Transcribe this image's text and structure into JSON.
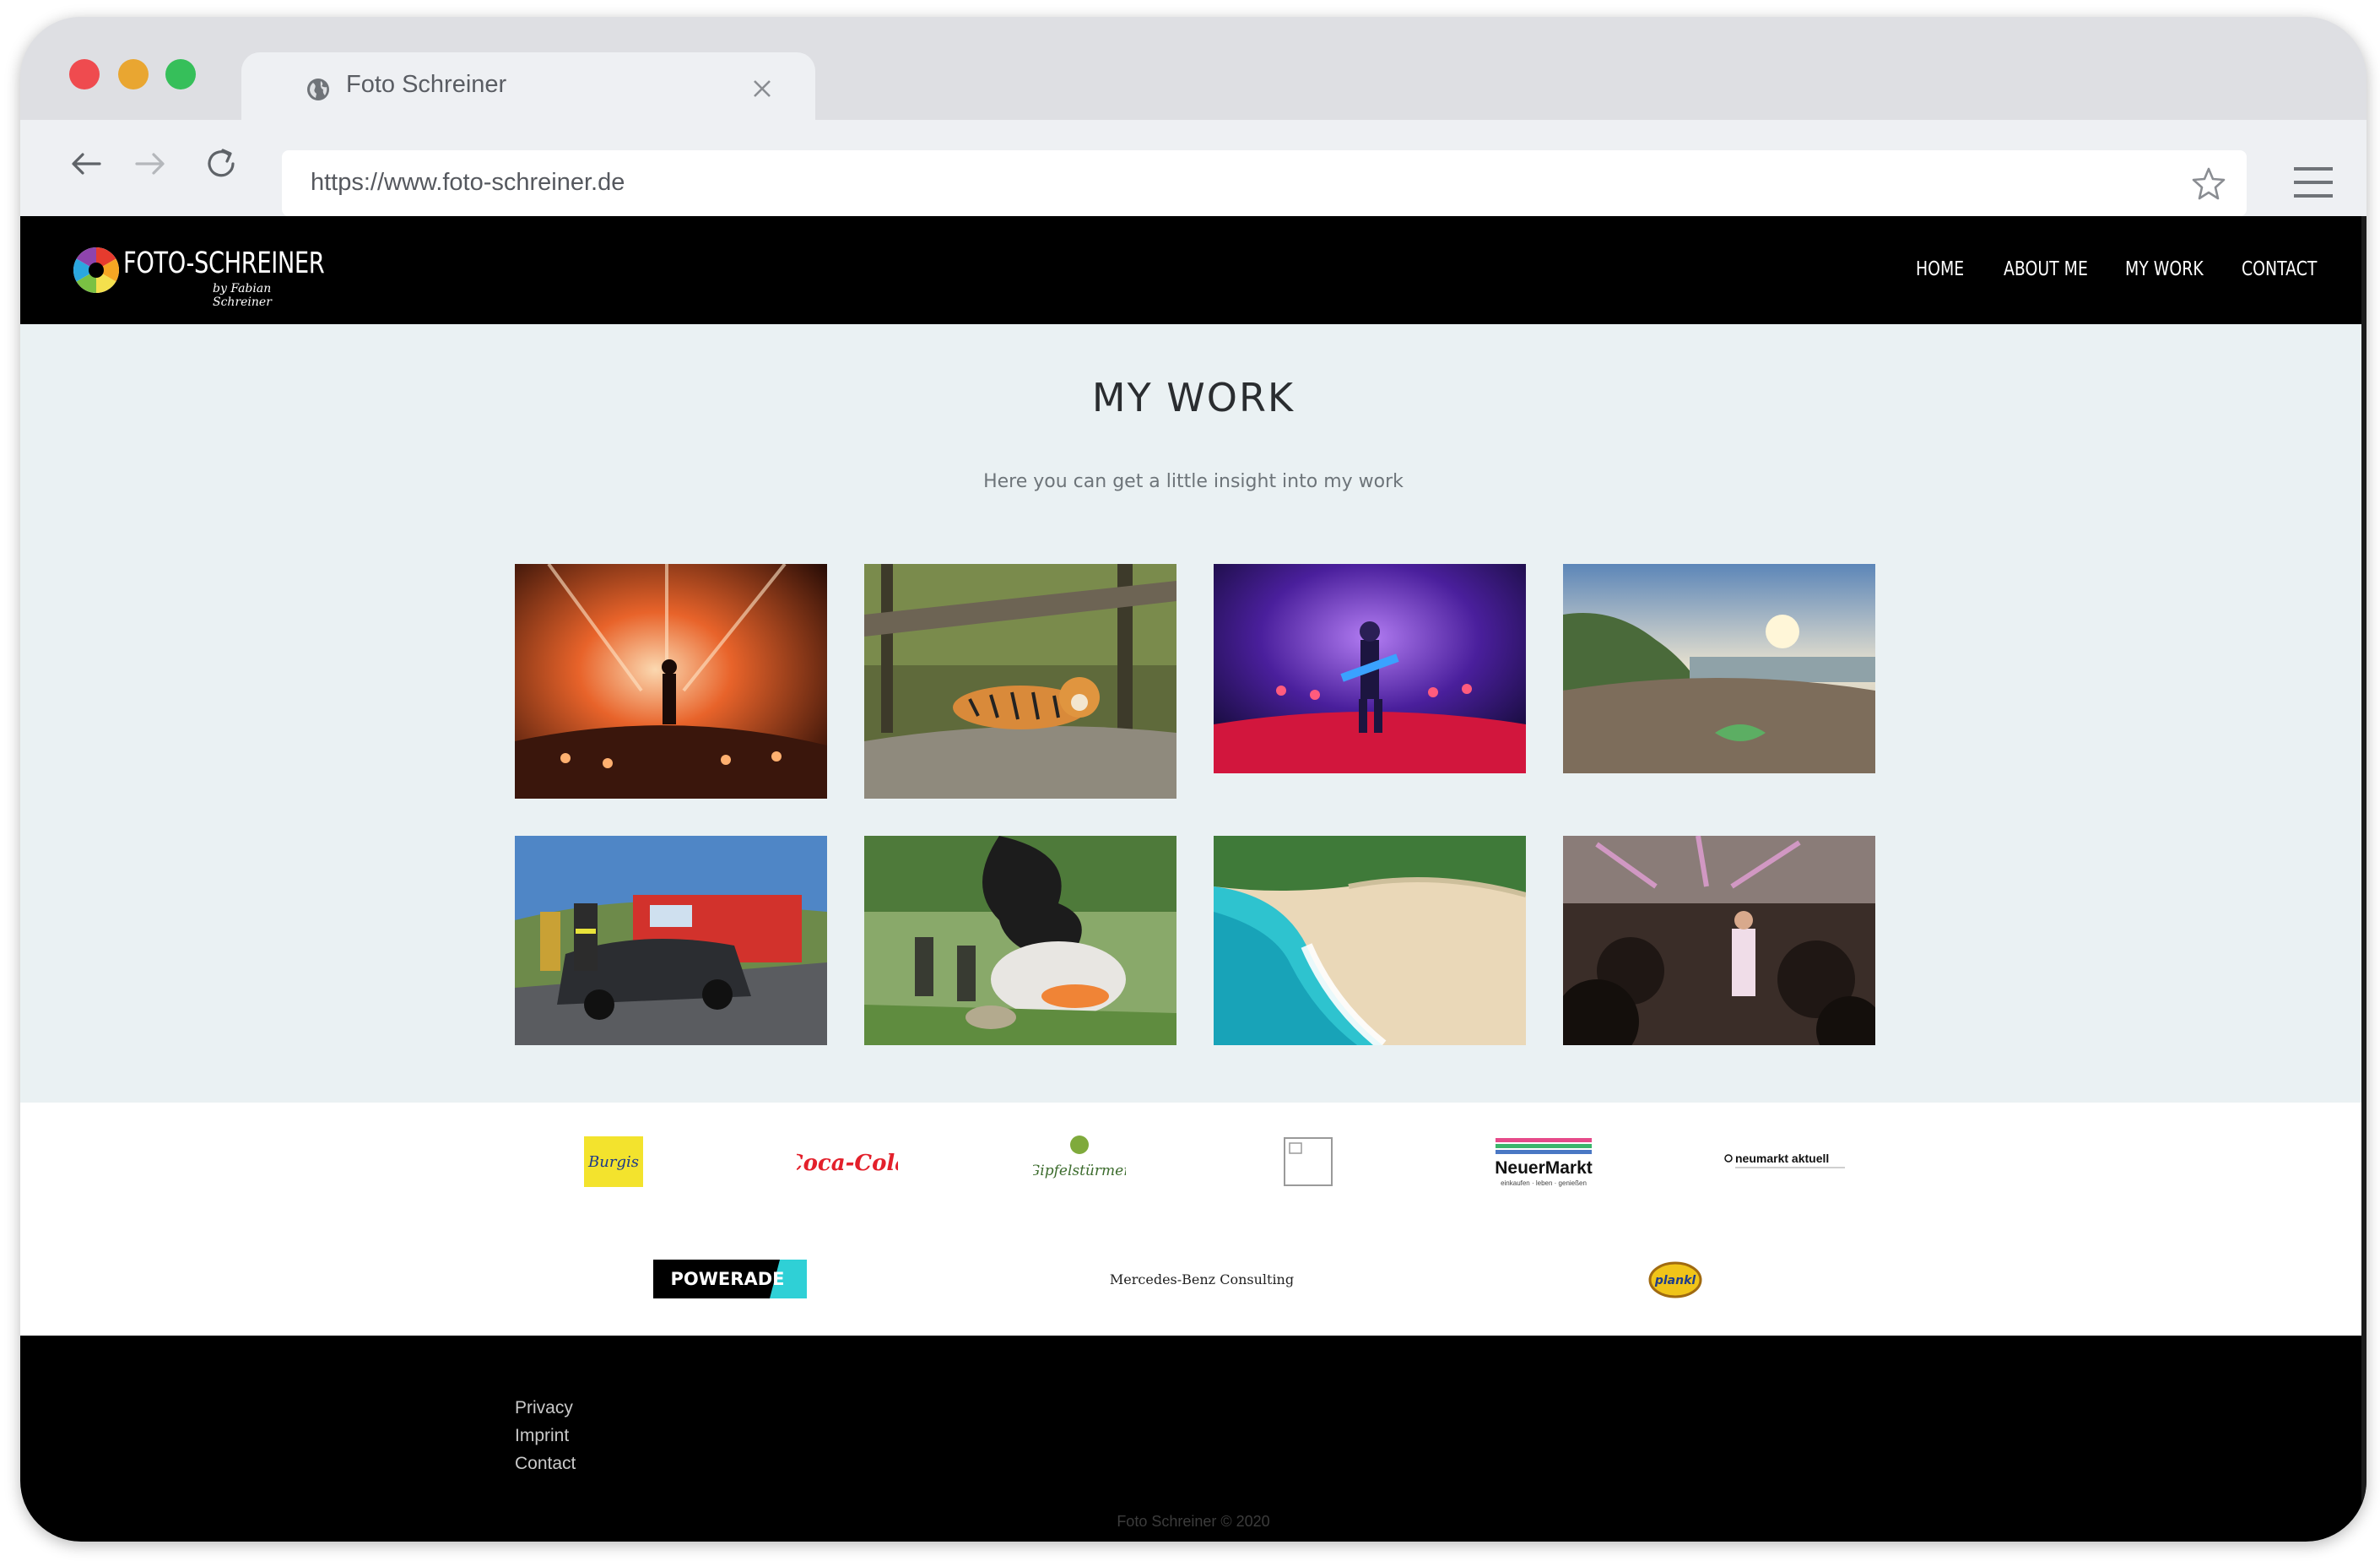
{
  "browser": {
    "tab_title": "Foto Schreiner",
    "url": "https://www.foto-schreiner.de"
  },
  "site": {
    "logo_text": "FOTO-SCHREINER",
    "logo_signature": "by Fabian Schreiner",
    "nav": [
      "HOME",
      "ABOUT ME",
      "MY WORK",
      "CONTACT"
    ]
  },
  "work": {
    "title": "MY WORK",
    "subtitle": "Here you can get a little insight into my work",
    "photos": [
      "concert-stage-orange-lights",
      "tiger-lying-on-tree-trunk",
      "guitarist-on-purple-stage",
      "coastal-rocks-at-sunset",
      "firefighters-at-car-accident",
      "firefighters-extinguishing-car-fire",
      "tropical-beach-aerial",
      "singer-in-crowded-hall"
    ]
  },
  "partners": {
    "burgis_text": "Burgis",
    "cocacola_text": "Coca-Cola",
    "gipfelstuermer_text": "Gipfelstürmer",
    "neuermarkt_text": "NeuerMarkt",
    "neuermarkt_tagline": "einkaufen · leben · genießen",
    "neumarkt_aktuell_text": "neumarkt aktuell",
    "powerade_text": "POWERADE",
    "mercedes_text": "Mercedes-Benz Consulting",
    "plankl_text": "plankl"
  },
  "footer": {
    "links": [
      "Privacy",
      "Imprint",
      "Contact"
    ],
    "copyright": "Foto Schreiner © 2020"
  },
  "colors": {
    "header_bg": "#000000",
    "page_bg": "#eaf1f3",
    "chrome_bg": "#dedfe3",
    "close_red": "#ef4b4f",
    "minimize_yellow": "#e9a631",
    "maximize_green": "#36bf5a"
  }
}
